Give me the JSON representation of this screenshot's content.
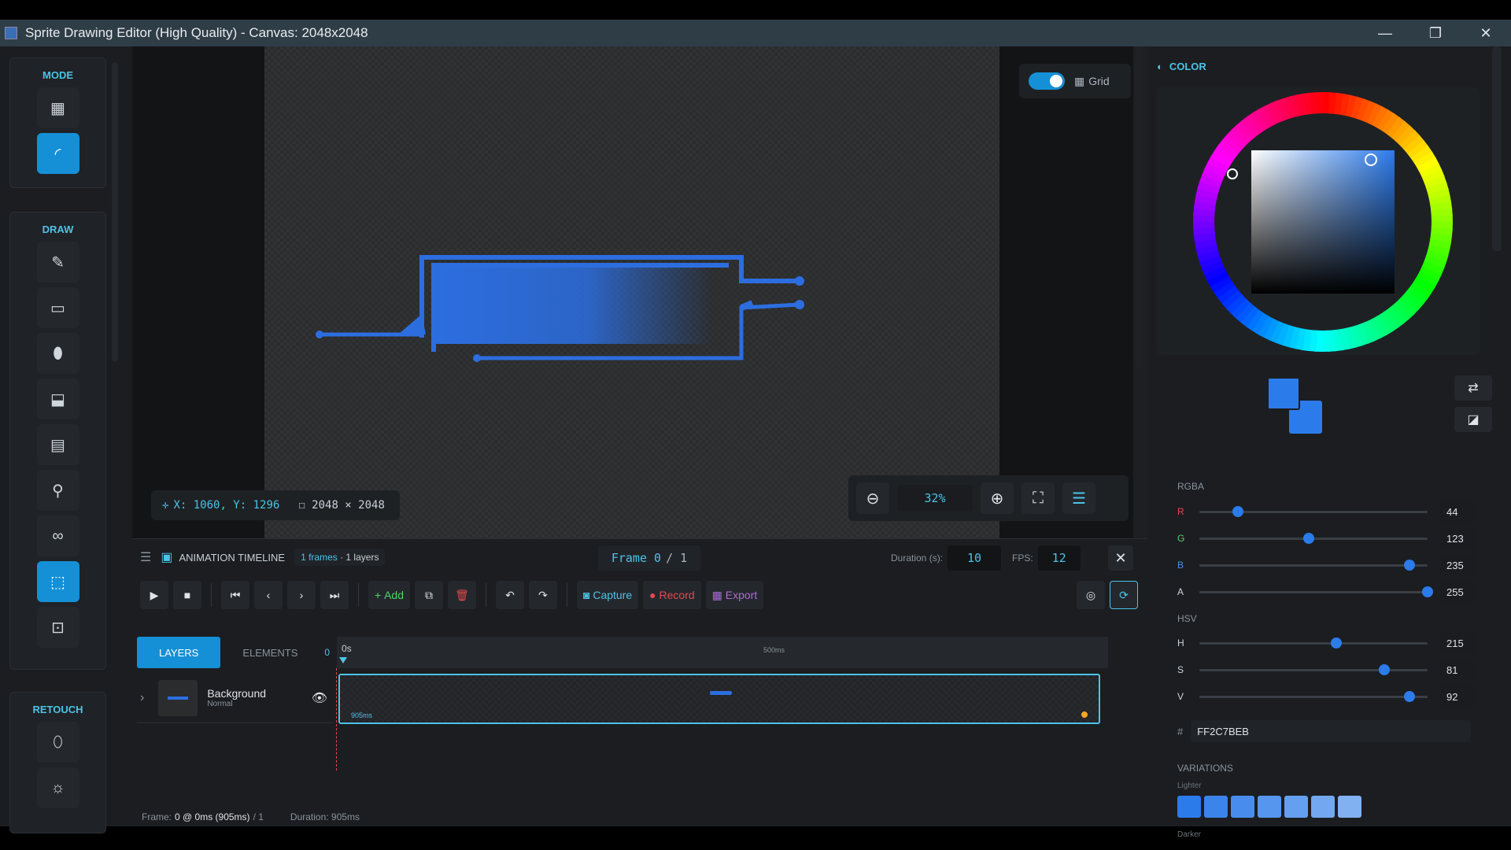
{
  "window": {
    "title": "Sprite Drawing Editor (High Quality) - Canvas: 2048x2048",
    "buttons": {
      "minimize": "—",
      "maximize": "❐",
      "close": "✕"
    }
  },
  "toolbar": {
    "groups": [
      {
        "label": "MODE",
        "tools": [
          {
            "name": "pixel-mode-tool",
            "icon": "▦",
            "active": false
          },
          {
            "name": "vector-mode-tool",
            "icon": "◜",
            "active": true
          }
        ]
      },
      {
        "label": "DRAW",
        "tools": [
          {
            "name": "pencil-tool",
            "icon": "✎",
            "active": false
          },
          {
            "name": "eraser-tool",
            "icon": "▭",
            "active": false
          },
          {
            "name": "bucket-tool",
            "icon": "⬮",
            "active": false
          },
          {
            "name": "fill-tool",
            "icon": "⬓",
            "active": false
          },
          {
            "name": "gradient-tool",
            "icon": "▤",
            "active": false
          },
          {
            "name": "eyedropper-tool",
            "icon": "⚲",
            "active": false
          },
          {
            "name": "symmetry-tool",
            "icon": "∞",
            "active": false
          },
          {
            "name": "select-tool",
            "icon": "⬚",
            "active": true
          },
          {
            "name": "transform-tool",
            "icon": "⊡",
            "active": false
          }
        ]
      },
      {
        "label": "RETOUCH",
        "tools": [
          {
            "name": "smudge-tool",
            "icon": "⬯",
            "active": false
          },
          {
            "name": "brightness-tool",
            "icon": "☼",
            "active": false
          }
        ]
      }
    ]
  },
  "canvas": {
    "grid_label": "Grid",
    "grid_on": true,
    "coords": "X: 1060, Y: 1296",
    "size": "2048 × 2048",
    "zoom": "32%"
  },
  "timeline": {
    "title": "ANIMATION TIMELINE",
    "frames_count": "1 frames",
    "layers_count": "1 layers",
    "frame_current": "Frame 0",
    "frame_total": "/ 1",
    "duration_label": "Duration (s):",
    "duration_value": "10",
    "fps_label": "FPS:",
    "fps_value": "12",
    "buttons": {
      "add": "Add",
      "capture": "Capture",
      "record": "Record",
      "export": "Export"
    },
    "tabs": {
      "layers": "LAYERS",
      "elements": "ELEMENTS",
      "elements_count": "0"
    },
    "ruler": {
      "start": "0s",
      "mid": "500ms"
    },
    "layer": {
      "name": "Background",
      "mode": "Normal"
    },
    "track_label": "905ms",
    "footer": {
      "frame_label": "Frame:",
      "frame_value": "0 @ 0ms (905ms)",
      "frame_total": "/ 1",
      "duration": "Duration: 905ms"
    }
  },
  "color_panel": {
    "title": "COLOR",
    "primary": "#2c7beb",
    "secondary": "#2c7beb",
    "rgba_label": "RGBA",
    "rgba": [
      {
        "label": "R",
        "value": "44",
        "fraction": 0.17,
        "color": "#e5484d"
      },
      {
        "label": "G",
        "value": "123",
        "fraction": 0.48,
        "color": "#4fd36b"
      },
      {
        "label": "B",
        "value": "235",
        "fraction": 0.92,
        "color": "#4c8ee8"
      },
      {
        "label": "A",
        "value": "255",
        "fraction": 1.0,
        "color": "#cfd6dc"
      }
    ],
    "hsv_label": "HSV",
    "hsv": [
      {
        "label": "H",
        "value": "215",
        "fraction": 0.6,
        "color": "#cfd6dc"
      },
      {
        "label": "S",
        "value": "81",
        "fraction": 0.81,
        "color": "#cfd6dc"
      },
      {
        "label": "V",
        "value": "92",
        "fraction": 0.92,
        "color": "#cfd6dc"
      }
    ],
    "hex_label": "#",
    "hex_value": "FF2C7BEB",
    "variations_label": "VARIATIONS",
    "lighter_label": "Lighter",
    "darker_label": "Darker",
    "lighter": [
      "#2c7beb",
      "#3a84ec",
      "#488ded",
      "#5796ee",
      "#659fef",
      "#73a8f0",
      "#82b1f1"
    ]
  }
}
